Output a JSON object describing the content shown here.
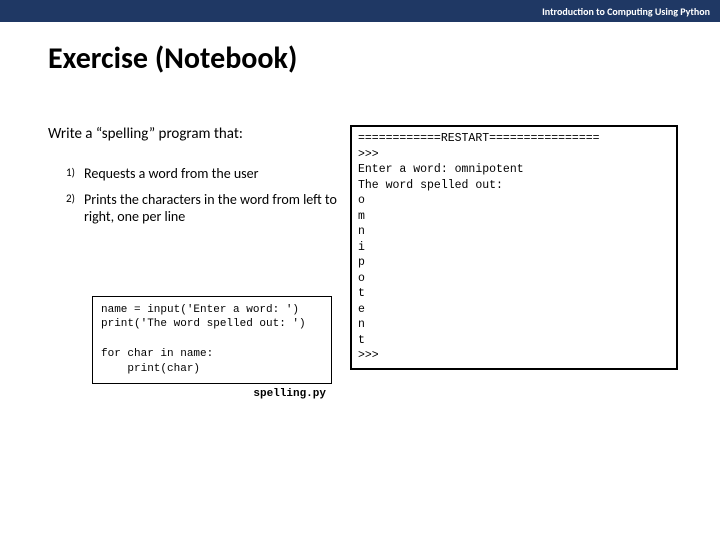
{
  "header": {
    "course": "Introduction to Computing Using Python"
  },
  "title": "Exercise (Notebook)",
  "prompt": "Write a “spelling” program that:",
  "steps": [
    {
      "num": "1)",
      "text": "Requests a word from the user"
    },
    {
      "num": "2)",
      "text": "Prints the characters in the word from left to right, one per line"
    }
  ],
  "code": "name = input('Enter a word: ')\nprint('The word spelled out: ')\n\nfor char in name:\n    print(char)",
  "code_filename": "spelling.py",
  "output": "============RESTART================\n>>>\nEnter a word: omnipotent\nThe word spelled out:\no\nm\nn\ni\np\no\nt\ne\nn\nt\n>>>"
}
